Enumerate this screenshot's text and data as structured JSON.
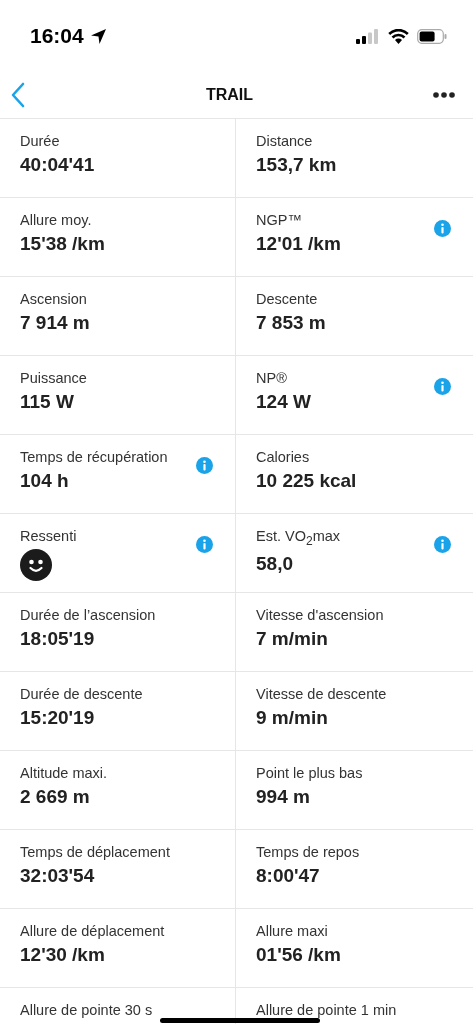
{
  "status_bar": {
    "time": "16:04"
  },
  "nav": {
    "title": "TRAIL"
  },
  "rows": [
    [
      {
        "label": "Durée",
        "value": "40:04'41",
        "kind": "text",
        "info": false
      },
      {
        "label": "Distance",
        "value": "153,7 km",
        "kind": "text",
        "info": false
      }
    ],
    [
      {
        "label": "Allure moy.",
        "value": "15'38 /km",
        "kind": "text",
        "info": false
      },
      {
        "label": "NGP™",
        "value": "12'01 /km",
        "kind": "text",
        "info": true
      }
    ],
    [
      {
        "label": "Ascension",
        "value": "7 914 m",
        "kind": "text",
        "info": false
      },
      {
        "label": "Descente",
        "value": "7 853 m",
        "kind": "text",
        "info": false
      }
    ],
    [
      {
        "label": "Puissance",
        "value": "115 W",
        "kind": "text",
        "info": false
      },
      {
        "label": "NP®",
        "value": "124 W",
        "kind": "text",
        "info": true
      }
    ],
    [
      {
        "label": "Temps de récupération",
        "value": "104 h",
        "kind": "text",
        "info": true
      },
      {
        "label": "Calories",
        "value": "10 225 kcal",
        "kind": "text",
        "info": false
      }
    ],
    [
      {
        "label": "Ressenti",
        "kind": "mood",
        "info": true
      },
      {
        "label": "Est. VO$_{2}$max",
        "value": "58,0",
        "kind": "text",
        "info": true
      }
    ],
    [
      {
        "label": "Durée de l’ascension",
        "value": "18:05'19",
        "kind": "text",
        "info": false
      },
      {
        "label": "Vitesse d'ascension",
        "value": "7 m/min",
        "kind": "text",
        "info": false
      }
    ],
    [
      {
        "label": "Durée de descente",
        "value": "15:20'19",
        "kind": "text",
        "info": false
      },
      {
        "label": "Vitesse de descente",
        "value": "9 m/min",
        "kind": "text",
        "info": false
      }
    ],
    [
      {
        "label": "Altitude maxi.",
        "value": "2 669 m",
        "kind": "text",
        "info": false
      },
      {
        "label": "Point le plus bas",
        "value": "994 m",
        "kind": "text",
        "info": false
      }
    ],
    [
      {
        "label": "Temps de déplacement",
        "value": "32:03'54",
        "kind": "text",
        "info": false
      },
      {
        "label": "Temps de repos",
        "value": "8:00'47",
        "kind": "text",
        "info": false
      }
    ],
    [
      {
        "label": "Allure de déplacement",
        "value": "12'30 /km",
        "kind": "text",
        "info": false
      },
      {
        "label": "Allure maxi",
        "value": "01'56 /km",
        "kind": "text",
        "info": false
      }
    ],
    [
      {
        "label": "Allure de pointe 30 s",
        "kind": "text",
        "info": false
      },
      {
        "label": "Allure de pointe 1 min",
        "kind": "text",
        "info": false
      }
    ]
  ]
}
